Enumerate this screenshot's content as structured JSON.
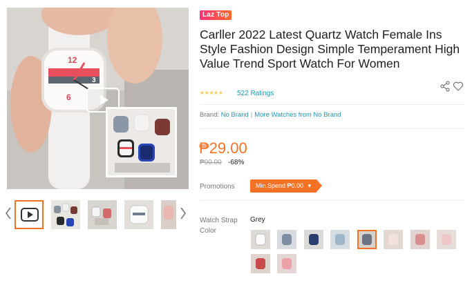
{
  "badge": {
    "label": "Laz Top"
  },
  "product": {
    "title": "Carller 2022 Latest Quartz Watch Female Ins Style Fashion Design Simple Temperament High Value Trend Sport Watch For Women"
  },
  "rating": {
    "stars": "★★★★★",
    "text": "522 Ratings"
  },
  "brand": {
    "label": "Brand:",
    "name": "No Brand",
    "separator": "|",
    "more_link": "More Watches from No Brand"
  },
  "price": {
    "current": "₱29.00",
    "original": "₱90.00",
    "discount": "-68%"
  },
  "promotions": {
    "label": "Promotions",
    "tag": "Min.Spend ₱0.00",
    "chevron": "▾"
  },
  "variation": {
    "label": "Watch Strap Color",
    "selected_value": "Grey",
    "options": [
      "white",
      "blue-grey",
      "navy",
      "light-blue",
      "grey",
      "pink-white",
      "rose",
      "pastel-pink",
      "red",
      "pink"
    ]
  },
  "gallery": {
    "thumbnails": [
      "video",
      "watch-set-1",
      "watch-set-2",
      "watch-set-3",
      "watch-set-4"
    ]
  },
  "icons": [
    "share-icon",
    "heart-icon",
    "chevron-left-icon",
    "chevron-right-icon",
    "play-icon",
    "star-icon"
  ],
  "colors": {
    "accent": "#f57224",
    "link": "#1a9cb7",
    "star": "#faca51",
    "badge_start": "#f5337b",
    "badge_end": "#ff6a2a"
  }
}
